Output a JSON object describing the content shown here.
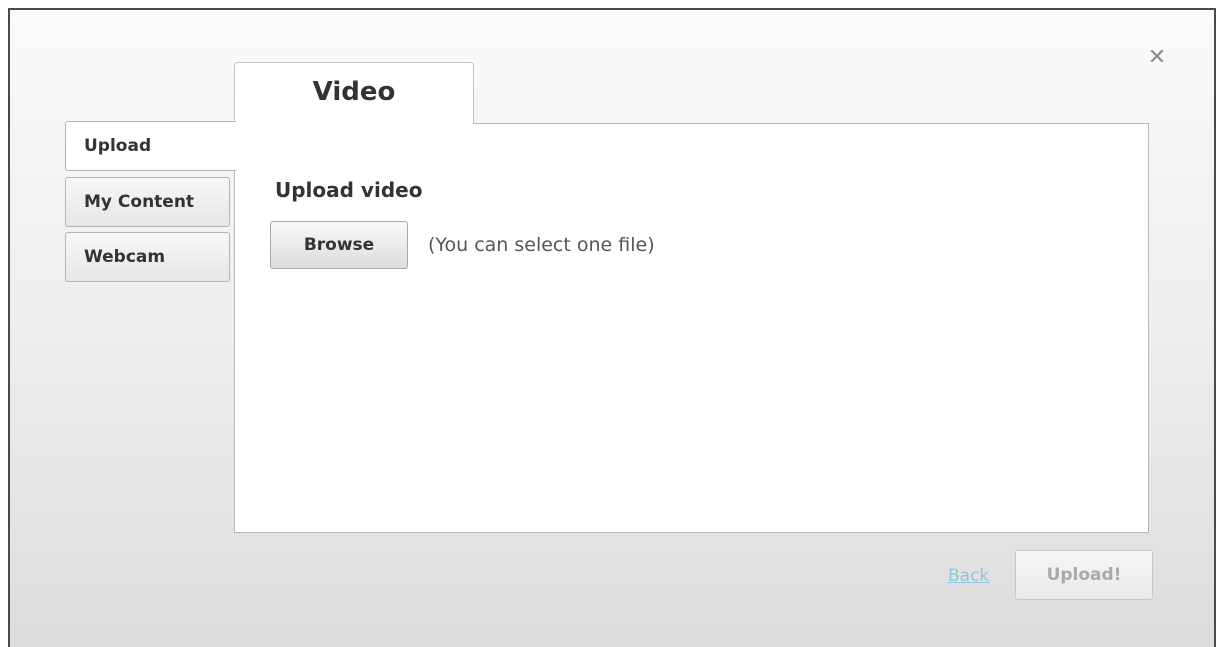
{
  "dialog": {
    "close_icon": "close-icon",
    "close_glyph": "✕"
  },
  "header": {
    "title": "Video"
  },
  "sidebar": {
    "items": [
      {
        "label": "Upload",
        "active": true
      },
      {
        "label": "My Content",
        "active": false
      },
      {
        "label": "Webcam",
        "active": false
      }
    ]
  },
  "main": {
    "heading": "Upload video",
    "browse_label": "Browse",
    "hint": "(You can select one file)"
  },
  "footer": {
    "back_label": "Back",
    "upload_label": "Upload!",
    "upload_disabled": true
  },
  "colors": {
    "link": "#8fc5dc",
    "disabled_text": "#a9a9a9"
  }
}
